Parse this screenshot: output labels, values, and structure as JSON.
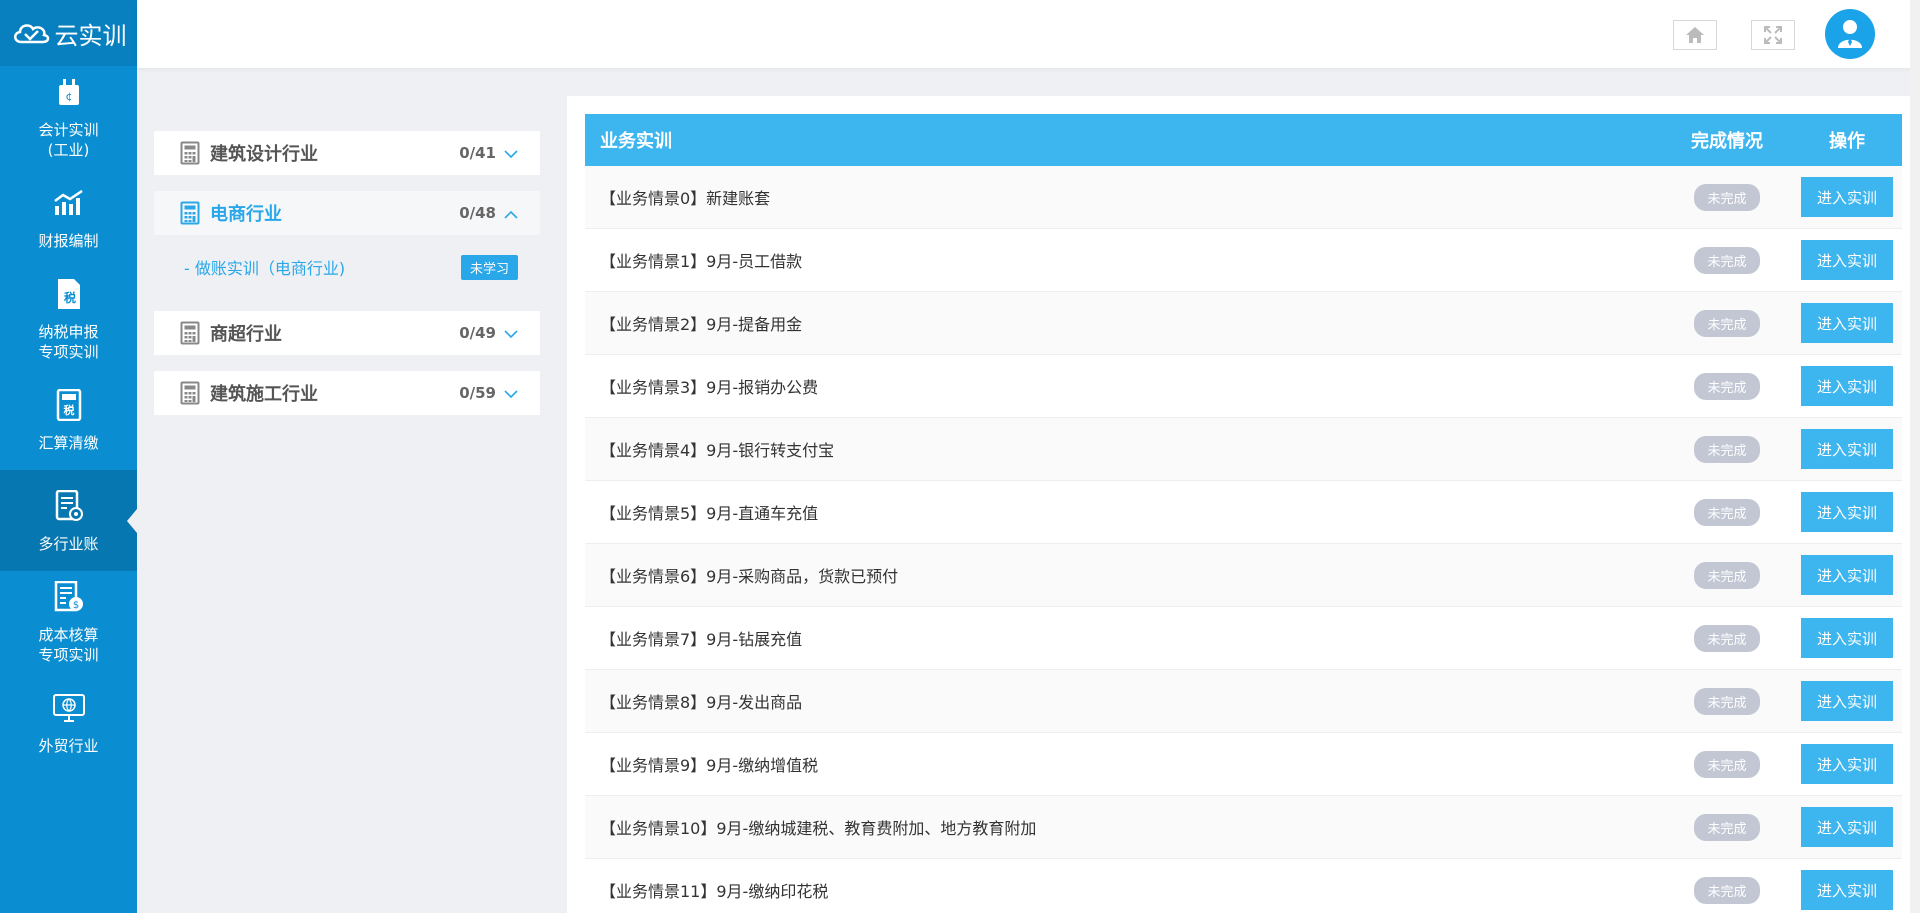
{
  "brand": {
    "name": "云实训"
  },
  "sidebar": {
    "items": [
      {
        "label": "会计实训\n(工业)",
        "icon": "accounting-icon",
        "active": false
      },
      {
        "label": "财报编制",
        "icon": "chart-icon",
        "active": false
      },
      {
        "label": "纳税申报\n专项实训",
        "icon": "tax-report-icon",
        "active": false
      },
      {
        "label": "汇算清缴",
        "icon": "calculator-tax-icon",
        "active": false
      },
      {
        "label": "多行业账",
        "icon": "multi-ledger-icon",
        "active": true
      },
      {
        "label": "成本核算\n专项实训",
        "icon": "cost-icon",
        "active": false
      },
      {
        "label": "外贸行业",
        "icon": "globe-monitor-icon",
        "active": false
      }
    ]
  },
  "header": {
    "home_icon": "home-icon",
    "fullscreen_icon": "fullscreen-icon",
    "avatar_icon": "user-icon"
  },
  "categories": [
    {
      "name": "建筑设计行业",
      "count": "0/41",
      "open": false
    },
    {
      "name": "电商行业",
      "count": "0/48",
      "open": true,
      "sub": {
        "label": "- 做账实训（电商行业)",
        "badge": "未学习"
      }
    },
    {
      "name": "商超行业",
      "count": "0/49",
      "open": false
    },
    {
      "name": "建筑施工行业",
      "count": "0/59",
      "open": false
    }
  ],
  "table": {
    "headers": {
      "task": "业务实训",
      "status": "完成情况",
      "action": "操作"
    },
    "rows": [
      {
        "task": "【业务情景0】新建账套",
        "status": "未完成",
        "action": "进入实训"
      },
      {
        "task": "【业务情景1】9月-员工借款",
        "status": "未完成",
        "action": "进入实训"
      },
      {
        "task": "【业务情景2】9月-提备用金",
        "status": "未完成",
        "action": "进入实训"
      },
      {
        "task": "【业务情景3】9月-报销办公费",
        "status": "未完成",
        "action": "进入实训"
      },
      {
        "task": "【业务情景4】9月-银行转支付宝",
        "status": "未完成",
        "action": "进入实训"
      },
      {
        "task": "【业务情景5】9月-直通车充值",
        "status": "未完成",
        "action": "进入实训"
      },
      {
        "task": "【业务情景6】9月-采购商品，货款已预付",
        "status": "未完成",
        "action": "进入实训"
      },
      {
        "task": "【业务情景7】9月-钻展充值",
        "status": "未完成",
        "action": "进入实训"
      },
      {
        "task": "【业务情景8】9月-发出商品",
        "status": "未完成",
        "action": "进入实训"
      },
      {
        "task": "【业务情景9】9月-缴纳增值税",
        "status": "未完成",
        "action": "进入实训"
      },
      {
        "task": "【业务情景10】9月-缴纳城建税、教育费附加、地方教育附加",
        "status": "未完成",
        "action": "进入实训"
      },
      {
        "task": "【业务情景11】9月-缴纳印花税",
        "status": "未完成",
        "action": "进入实训"
      }
    ]
  }
}
